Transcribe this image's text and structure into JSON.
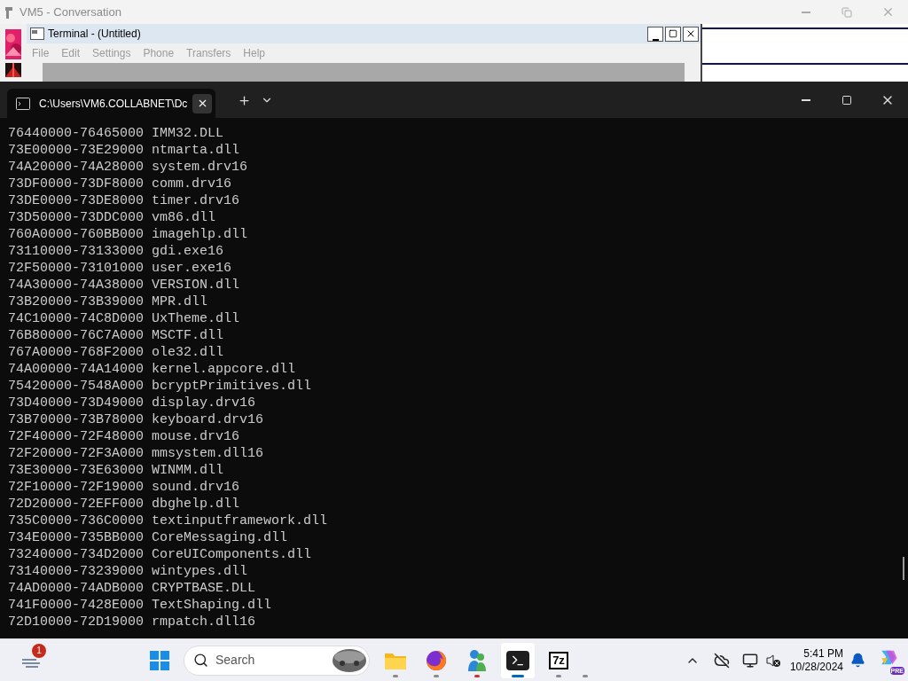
{
  "background_window": {
    "title": "VM5 - Conversation"
  },
  "inner_window": {
    "title": "Terminal - (Untitled)",
    "menu": [
      "File",
      "Edit",
      "Settings",
      "Phone",
      "Transfers",
      "Help"
    ]
  },
  "terminal": {
    "tabs": [
      {
        "title": "C:\\Users\\VM6.COLLABNET\\Dc",
        "selected": true
      }
    ],
    "lines": [
      {
        "range": "76440000-76465000",
        "module": "IMM32.DLL"
      },
      {
        "range": "73E00000-73E29000",
        "module": "ntmarta.dll"
      },
      {
        "range": "74A20000-74A28000",
        "module": "system.drv16"
      },
      {
        "range": "73DF0000-73DF8000",
        "module": "comm.drv16"
      },
      {
        "range": "73DE0000-73DE8000",
        "module": "timer.drv16"
      },
      {
        "range": "73D50000-73DDC000",
        "module": "vm86.dll"
      },
      {
        "range": "760A0000-760BB000",
        "module": "imagehlp.dll"
      },
      {
        "range": "73110000-73133000",
        "module": "gdi.exe16"
      },
      {
        "range": "72F50000-73101000",
        "module": "user.exe16"
      },
      {
        "range": "74A30000-74A38000",
        "module": "VERSION.dll"
      },
      {
        "range": "73B20000-73B39000",
        "module": "MPR.dll"
      },
      {
        "range": "74C10000-74C8D000",
        "module": "UxTheme.dll"
      },
      {
        "range": "76B80000-76C7A000",
        "module": "MSCTF.dll"
      },
      {
        "range": "767A0000-768F2000",
        "module": "ole32.dll"
      },
      {
        "range": "74A00000-74A14000",
        "module": "kernel.appcore.dll"
      },
      {
        "range": "75420000-7548A000",
        "module": "bcryptPrimitives.dll"
      },
      {
        "range": "73D40000-73D49000",
        "module": "display.drv16"
      },
      {
        "range": "73B70000-73B78000",
        "module": "keyboard.drv16"
      },
      {
        "range": "72F40000-72F48000",
        "module": "mouse.drv16"
      },
      {
        "range": "72F20000-72F3A000",
        "module": "mmsystem.dll16"
      },
      {
        "range": "73E30000-73E63000",
        "module": "WINMM.dll"
      },
      {
        "range": "72F10000-72F19000",
        "module": "sound.drv16"
      },
      {
        "range": "72D20000-72EFF000",
        "module": "dbghelp.dll"
      },
      {
        "range": "735C0000-736C0000",
        "module": "textinputframework.dll"
      },
      {
        "range": "734E0000-735BB000",
        "module": "CoreMessaging.dll"
      },
      {
        "range": "73240000-734D2000",
        "module": "CoreUIComponents.dll"
      },
      {
        "range": "73140000-73239000",
        "module": "wintypes.dll"
      },
      {
        "range": "74AD0000-74ADB000",
        "module": "CRYPTBASE.DLL"
      },
      {
        "range": "741F0000-7428E000",
        "module": "TextShaping.dll"
      },
      {
        "range": "72D10000-72D19000",
        "module": "rmpatch.dll16"
      }
    ]
  },
  "taskbar": {
    "notification_count": "1",
    "search_placeholder": "Search",
    "apps": [
      {
        "kind": "folder",
        "selected": false,
        "color": "#8a8a8a"
      },
      {
        "kind": "browser",
        "selected": false,
        "color": "#8a8a8a"
      },
      {
        "kind": "messenger",
        "selected": false,
        "color": "#d13438"
      },
      {
        "kind": "terminal",
        "selected": true,
        "color": "#0067c0"
      },
      {
        "kind": "archiver",
        "label": "7z",
        "selected": false,
        "color": "#8a8a8a"
      }
    ],
    "time": "5:41 PM",
    "date": "10/28/2024",
    "copilot_badge": "PRE"
  }
}
